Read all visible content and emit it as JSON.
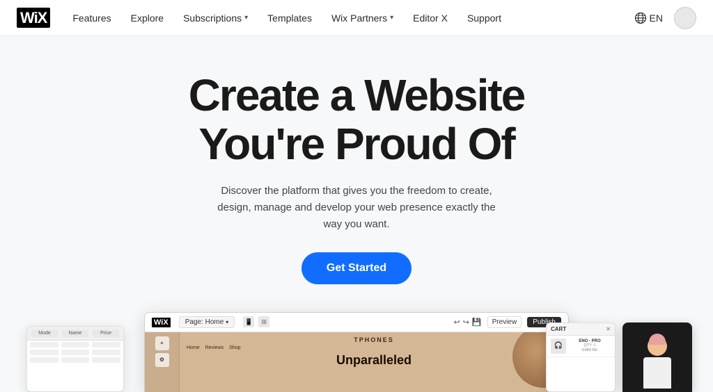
{
  "nav": {
    "logo": "WiX",
    "links": [
      {
        "label": "Features",
        "hasDropdown": false
      },
      {
        "label": "Explore",
        "hasDropdown": false
      },
      {
        "label": "Subscriptions",
        "hasDropdown": true
      },
      {
        "label": "Templates",
        "hasDropdown": false
      },
      {
        "label": "Wix Partners",
        "hasDropdown": true
      },
      {
        "label": "Editor X",
        "hasDropdown": false
      },
      {
        "label": "Support",
        "hasDropdown": false
      }
    ],
    "lang_label": "EN",
    "circle_label": ""
  },
  "hero": {
    "title_line1": "Create a Website",
    "title_line2": "You're Proud Of",
    "subtitle": "Discover the platform that gives you the freedom to create, design, manage and develop your web presence exactly the way you want.",
    "cta_label": "Get Started"
  },
  "editor_preview": {
    "logo": "WiX",
    "page_tab": "Page: Home",
    "preview_btn": "Preview",
    "publish_btn": "Publish",
    "canvas": {
      "brand": "TPHONES",
      "nav_links": [
        "Home",
        "Reviews",
        "Shop"
      ],
      "headline_line1": "Unparalleled"
    }
  },
  "cart_preview": {
    "header": "CART",
    "item": {
      "name": "ENO - PRO",
      "desc": "QTY: 1\nEMM RE"
    }
  },
  "table_preview": {
    "cols": [
      "Mode",
      "Name",
      "Price"
    ],
    "rows": [
      [
        "",
        "",
        ""
      ],
      [
        "",
        "",
        ""
      ],
      [
        "",
        "",
        ""
      ]
    ]
  }
}
